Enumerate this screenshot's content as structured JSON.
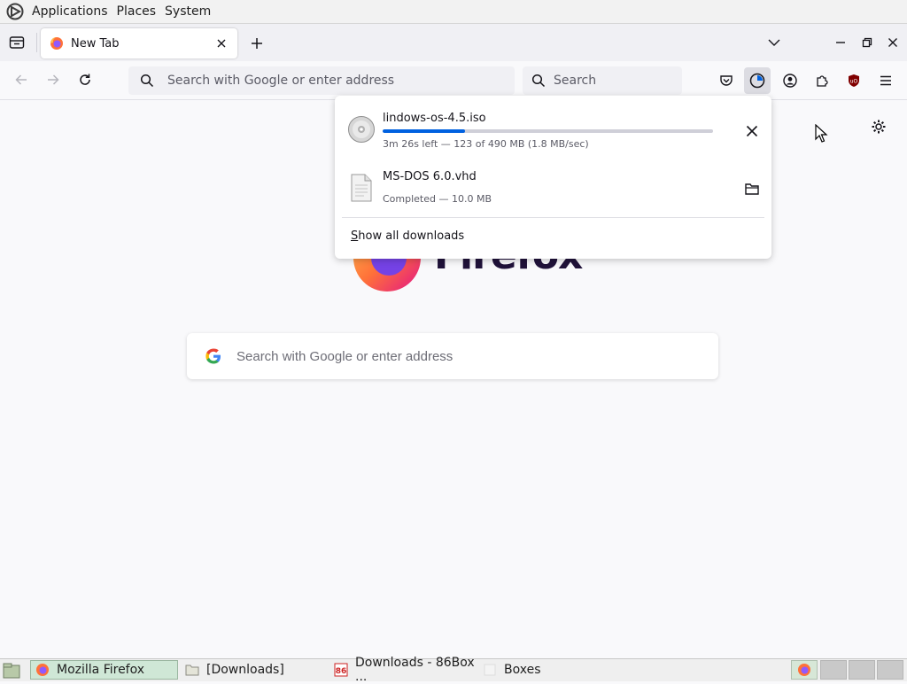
{
  "top_panel": {
    "menus": [
      "Applications",
      "Places",
      "System"
    ]
  },
  "tabs": {
    "active_tab_title": "New Tab"
  },
  "navbar": {
    "url_placeholder": "Search with Google or enter address",
    "search_placeholder": "Search"
  },
  "newtab": {
    "wordmark": "Firefox",
    "search_placeholder": "Search with Google or enter address"
  },
  "downloads_panel": {
    "items": [
      {
        "name": "lindows-os-4.5.iso",
        "status": "3m 26s left — 123 of 490 MB (1.8 MB/sec)",
        "progress_fraction": 0.25,
        "state": "downloading",
        "icon": "disc-icon"
      },
      {
        "name": "MS-DOS 6.0.vhd",
        "status": "Completed — 10.0 MB",
        "state": "completed",
        "icon": "file-icon"
      }
    ],
    "show_all_accesskey": "S",
    "show_all_rest": "how all downloads"
  },
  "taskbar": {
    "tasks": [
      "Mozilla Firefox",
      "[Downloads]",
      "Downloads - 86Box ...",
      "Boxes"
    ],
    "active_task": "Mozilla Firefox"
  },
  "colors": {
    "accent": "#0061e0",
    "ublock_red": "#800000",
    "active_task_bg": "#cfe7d6"
  }
}
